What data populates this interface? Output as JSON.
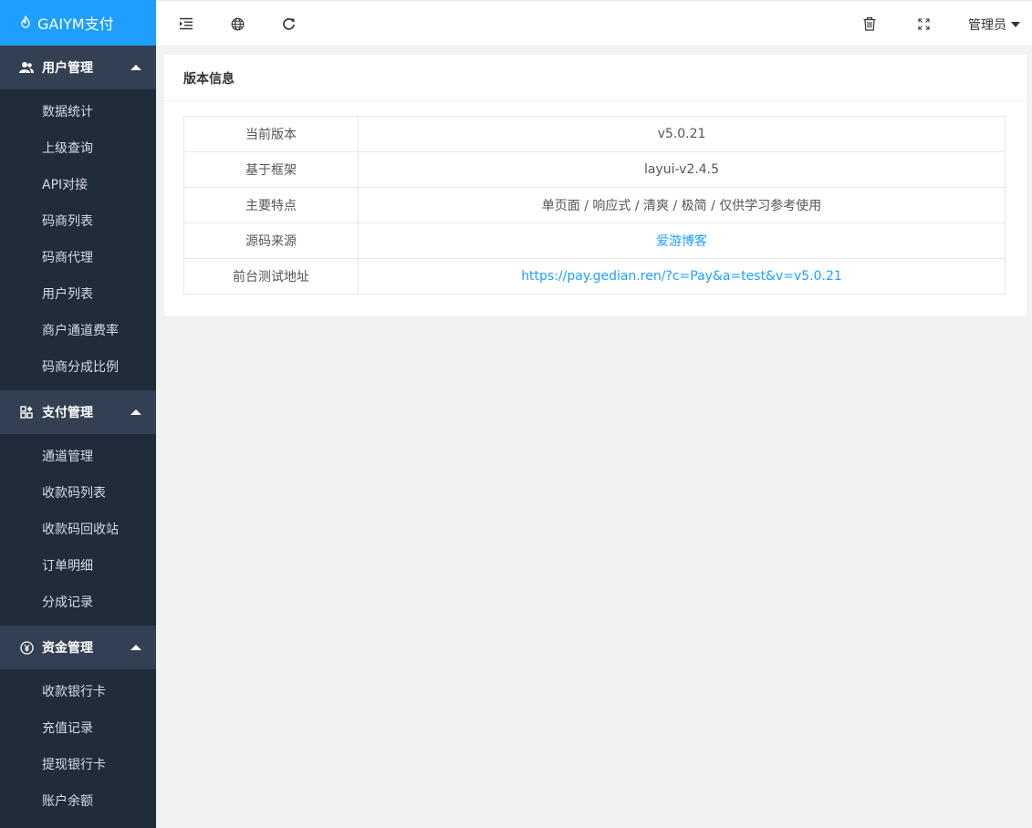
{
  "app": {
    "logo_text": "GAIYM支付",
    "logo_icon": "fire-icon",
    "brand_color": "#1e9fff",
    "sidebar_color": "#212c3b"
  },
  "sidebar": {
    "groups": [
      {
        "label": "用户管理",
        "icon": "users-icon",
        "items": [
          "数据统计",
          "上级查询",
          "API对接",
          "码商列表",
          "码商代理",
          "用户列表",
          "商户通道费率",
          "码商分成比例"
        ]
      },
      {
        "label": "支付管理",
        "icon": "apps-icon",
        "items": [
          "通道管理",
          "收款码列表",
          "收款码回收站",
          "订单明细",
          "分成记录"
        ]
      },
      {
        "label": "资金管理",
        "icon": "yen-circle-icon",
        "items": [
          "收款银行卡",
          "充值记录",
          "提现银行卡",
          "账户余额"
        ]
      }
    ]
  },
  "header": {
    "icons": [
      "indent-icon",
      "globe-icon",
      "refresh-icon",
      "trash-icon",
      "fullscreen-icon"
    ],
    "user_label": "管理员"
  },
  "main": {
    "card_title": "版本信息",
    "rows": [
      {
        "key": "当前版本",
        "value": "v5.0.21"
      },
      {
        "key": "基于框架",
        "value": "layui-v2.4.5"
      },
      {
        "key": "主要特点",
        "value": "单页面 / 响应式 / 清爽 / 极简 / 仅供学习参考使用"
      },
      {
        "key": "源码来源",
        "value": "爱游博客"
      },
      {
        "key": "前台测试地址",
        "value": "https://pay.gedian.ren/?c=Pay&a=test&v=v5.0.21"
      }
    ]
  }
}
